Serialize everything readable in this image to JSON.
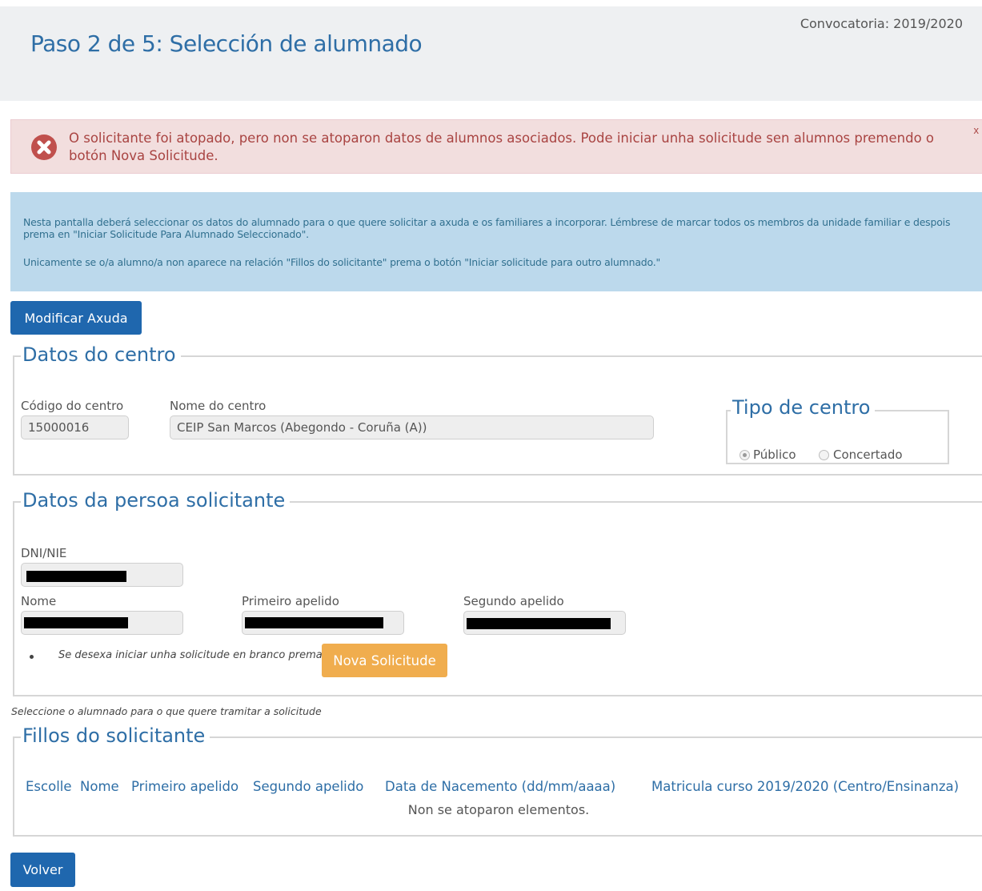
{
  "header": {
    "title": "Paso 2 de 5: Selección de alumnado",
    "convocatoria": "Convocatoria: 2019/2020"
  },
  "error_alert": {
    "message": "O solicitante foi atopado, pero non se atoparon datos de alumnos asociados. Pode iniciar unha solicitude sen alumnos premendo o botón Nova Solicitude.",
    "close_label": "x"
  },
  "info_alert": {
    "paragraph1": "Nesta pantalla deberá seleccionar os datos do alumnado para o que quere solicitar a axuda e os familiares a incorporar. Lémbrese de marcar todos os membros da unidade familiar e despois prema en \"Iniciar Solicitude Para Alumnado Seleccionado\".",
    "paragraph2": "Unicamente se o/a alumno/a non aparece na relación \"Fillos do solicitante\" prema o botón \"Iniciar solicitude para outro alumnado.\""
  },
  "buttons": {
    "modify": "Modificar Axuda",
    "new_request": "Nova Solicitude",
    "back": "Volver"
  },
  "centro": {
    "legend": "Datos do centro",
    "code_label": "Código do centro",
    "code_value": "15000016",
    "name_label": "Nome do centro",
    "name_value": "CEIP San Marcos (Abegondo - Coruña (A))",
    "type_legend": "Tipo de centro",
    "type_options": [
      "Público",
      "Concertado"
    ],
    "type_selected": "Público"
  },
  "solicitante": {
    "legend": "Datos da persoa solicitante",
    "dni_label": "DNI/NIE",
    "name_label": "Nome",
    "surname1_label": "Primeiro apelido",
    "surname2_label": "Segundo apelido",
    "blank_note": "Se desexa iniciar unha solicitude en branco prema"
  },
  "select_note": "Seleccione o alumnado para o que quere tramitar a solicitude",
  "fillos": {
    "legend": "Fillos do solicitante",
    "columns": [
      "Escolle",
      "Nome",
      "Primeiro apelido",
      "Segundo apelido",
      "Data de Nacemento (dd/mm/aaaa)",
      "Matricula curso 2019/2020 (Centro/Ensinanza)"
    ],
    "empty_message": "Non se atoparon elementos."
  },
  "colors": {
    "brand_blue": "#2e6ea6",
    "button_blue": "#1f67ae",
    "button_orange": "#f0ad4e",
    "error_bg": "#f2dede",
    "info_bg": "#bcd9ec"
  }
}
